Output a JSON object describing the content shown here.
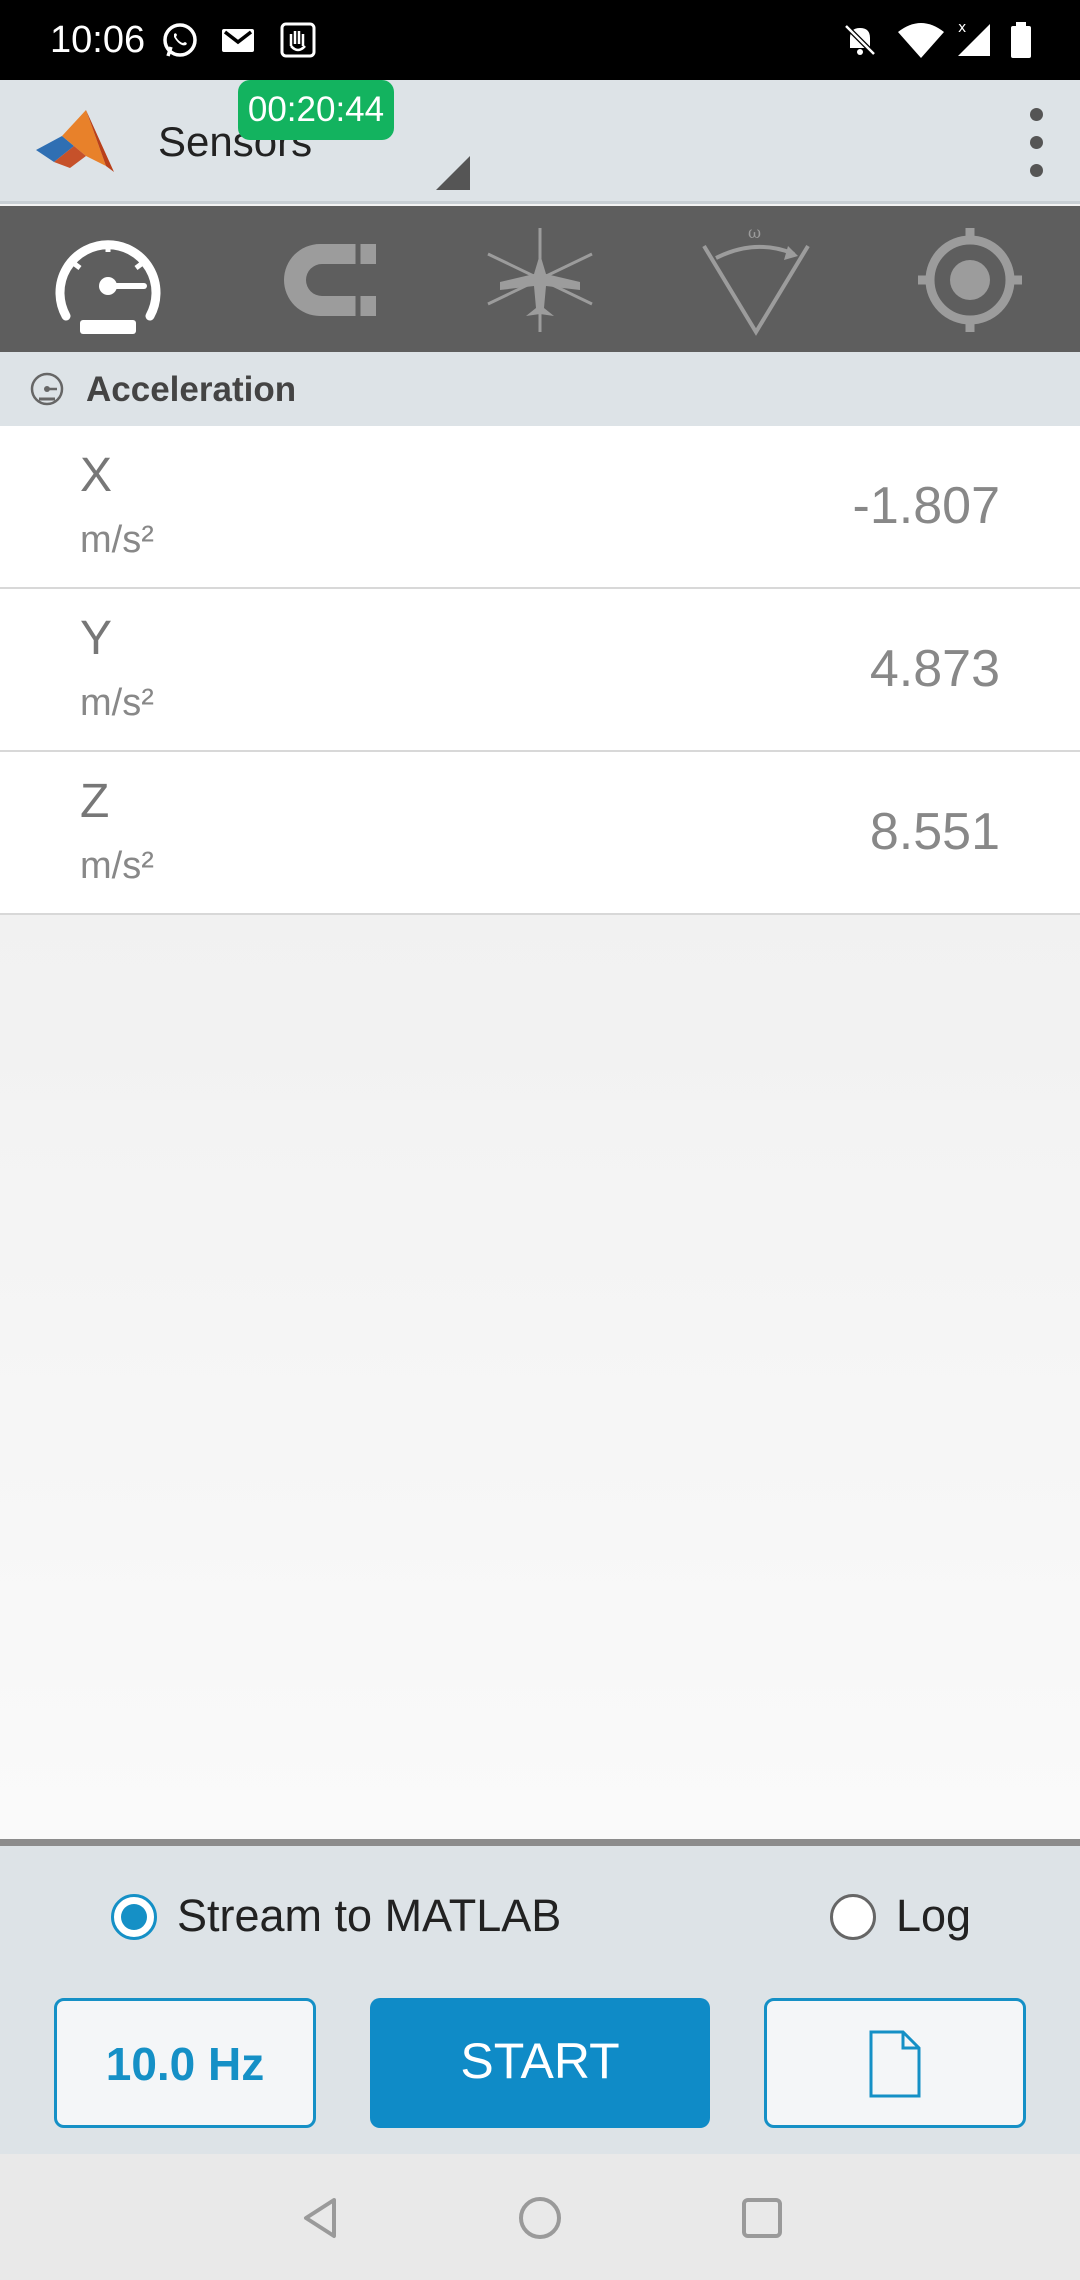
{
  "status_bar": {
    "time": "10:06",
    "left_icons": [
      "whatsapp-icon",
      "gmail-icon",
      "hand-icon"
    ],
    "right_icons": [
      "notifications-off-icon",
      "wifi-icon",
      "signal-icon",
      "battery-icon"
    ]
  },
  "app_bar": {
    "title": "Sensors",
    "timer": "00:20:44",
    "logo": "matlab-logo"
  },
  "sensor_tabs": [
    {
      "name": "acceleration",
      "icon": "speedometer-icon",
      "active": true
    },
    {
      "name": "magnetic-field",
      "icon": "magnet-icon",
      "active": false
    },
    {
      "name": "orientation",
      "icon": "airplane-axes-icon",
      "active": false
    },
    {
      "name": "angular-velocity",
      "icon": "angular-velocity-icon",
      "active": false
    },
    {
      "name": "position",
      "icon": "gps-target-icon",
      "active": false
    }
  ],
  "section": {
    "title": "Acceleration",
    "icon": "speedometer-icon"
  },
  "readings": [
    {
      "axis": "X",
      "unit": "m/s²",
      "value": "-1.807"
    },
    {
      "axis": "Y",
      "unit": "m/s²",
      "value": "4.873"
    },
    {
      "axis": "Z",
      "unit": "m/s²",
      "value": "8.551"
    }
  ],
  "bottom": {
    "stream_label": "Stream to MATLAB",
    "stream_selected": true,
    "log_label": "Log",
    "log_selected": false,
    "rate_label": "10.0 Hz",
    "start_label": "START",
    "file_icon": "document-icon"
  },
  "colors": {
    "accent": "#1590c6",
    "start_button": "#0f8bc7",
    "timer_badge": "#13b35f",
    "tab_bar": "#5e5e5e",
    "header_bg": "#dde3e7"
  }
}
